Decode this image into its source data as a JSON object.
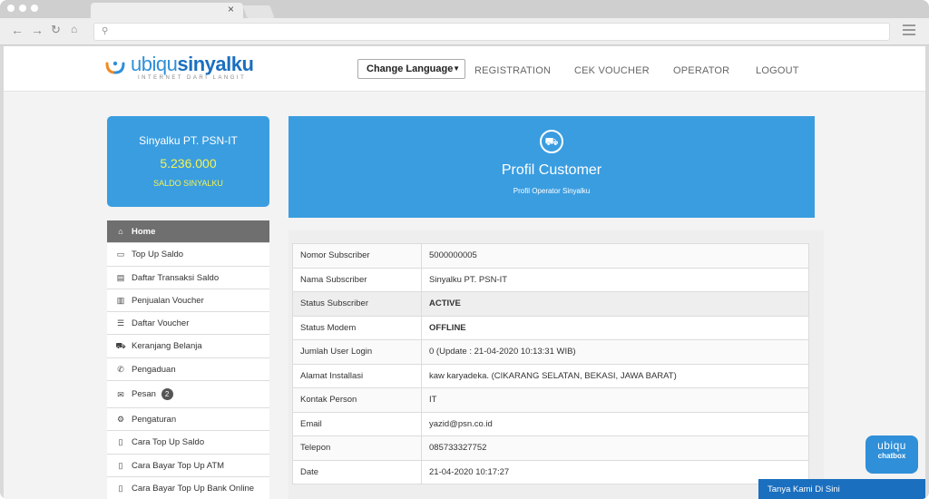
{
  "browser": {
    "tab_close": "×",
    "url_icon": "search-icon",
    "nav_icons": [
      "back-icon",
      "forward-icon",
      "reload-icon",
      "home-icon"
    ]
  },
  "header": {
    "logo_ubiqu": "ubiqu",
    "logo_sinyalku": "sinyalku",
    "logo_tagline": "INTERNET DARI LANGIT",
    "language_select": "Change Language",
    "nav": [
      "REGISTRATION",
      "CEK VOUCHER",
      "OPERATOR",
      "LOGOUT"
    ]
  },
  "balance": {
    "name": "Sinyalku PT. PSN-IT",
    "amount": "5.236.000",
    "label": "SALDO SINYALKU"
  },
  "menu": {
    "items": [
      {
        "label": "Home",
        "icon": "home-icon"
      },
      {
        "label": "Top Up Saldo",
        "icon": "credit-card-icon"
      },
      {
        "label": "Daftar Transaksi Saldo",
        "icon": "document-icon"
      },
      {
        "label": "Penjualan Voucher",
        "icon": "bar-chart-icon"
      },
      {
        "label": "Daftar Voucher",
        "icon": "list-icon"
      },
      {
        "label": "Keranjang Belanja",
        "icon": "cart-icon"
      },
      {
        "label": "Pengaduan",
        "icon": "phone-icon"
      },
      {
        "label": "Pesan",
        "icon": "envelope-icon",
        "badge": "2"
      },
      {
        "label": "Pengaturan",
        "icon": "gear-icon"
      },
      {
        "label": "Cara Top Up Saldo",
        "icon": "file-icon"
      },
      {
        "label": "Cara Bayar Top Up ATM",
        "icon": "file-icon"
      },
      {
        "label": "Cara Bayar Top Up Bank Online",
        "icon": "file-icon"
      }
    ]
  },
  "hero": {
    "icon": "cart-icon",
    "title": "Profil Customer",
    "subtitle": "Profil Operator Sinyalku"
  },
  "profile": {
    "rows": [
      {
        "label": "Nomor Subscriber",
        "value": "5000000005"
      },
      {
        "label": "Nama Subscriber",
        "value": "Sinyalku PT. PSN-IT"
      },
      {
        "label": "Status Subscriber",
        "value": "ACTIVE"
      },
      {
        "label": "Status Modem",
        "value": "OFFLINE"
      },
      {
        "label": "Jumlah User Login",
        "value": "0 (Update : 21-04-2020 10:13:31 WIB)"
      },
      {
        "label": "Alamat Installasi",
        "value": "kaw karyadeka. (CIKARANG SELATAN, BEKASI, JAWA BARAT)"
      },
      {
        "label": "Kontak Person",
        "value": "IT"
      },
      {
        "label": "Email",
        "value": "yazid@psn.co.id"
      },
      {
        "label": "Telepon",
        "value": "085733327752"
      },
      {
        "label": "Date",
        "value": "21-04-2020 10:17:27"
      }
    ]
  },
  "chat": {
    "brand": "ubiqu",
    "brand_sub": "chatbox",
    "bar_label": "Tanya Kami Di Sini"
  },
  "colors": {
    "primary": "#3a9de0",
    "highlight": "#f4f254",
    "offline": "#e01e1e",
    "menu_active": "#6f6f6f"
  }
}
